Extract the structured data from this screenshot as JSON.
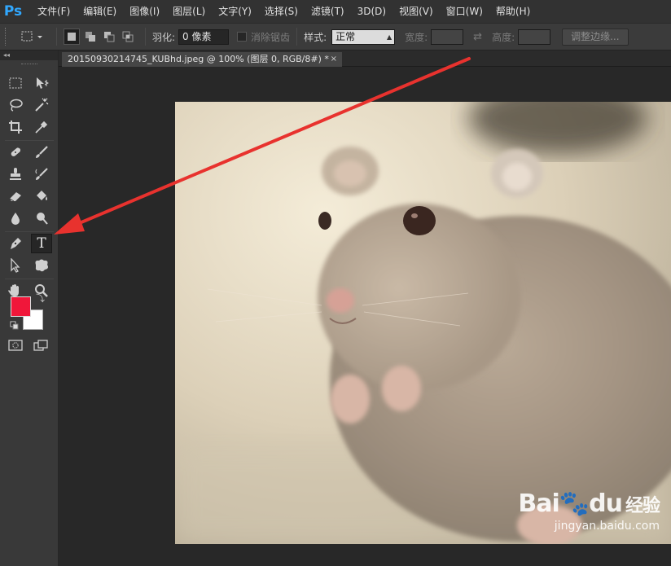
{
  "app": {
    "logo": "Ps",
    "menu": [
      "文件(F)",
      "编辑(E)",
      "图像(I)",
      "图层(L)",
      "文字(Y)",
      "选择(S)",
      "滤镜(T)",
      "3D(D)",
      "视图(V)",
      "窗口(W)",
      "帮助(H)"
    ]
  },
  "options": {
    "feather_label": "羽化:",
    "feather_value": "0 像素",
    "antialias_label": "消除锯齿",
    "style_label": "样式:",
    "style_value": "正常",
    "width_label": "宽度:",
    "height_label": "高度:",
    "refine_button": "调整边缘..."
  },
  "document": {
    "tab_title": "20150930214745_KUBhd.jpeg @ 100% (图层 0, RGB/8#) *",
    "close_glyph": "×"
  },
  "toolbar": {
    "collapse_glyph": "◂◂",
    "text_tool_glyph": "T",
    "foreground_color": "#f0173a",
    "background_color": "#ffffff"
  },
  "watermark": {
    "logo_bai": "Bai",
    "logo_du": "du",
    "logo_jingyan": "经验",
    "url": "jingyan.baidu.com"
  },
  "annotation": {
    "arrow_color": "#e8322e"
  }
}
